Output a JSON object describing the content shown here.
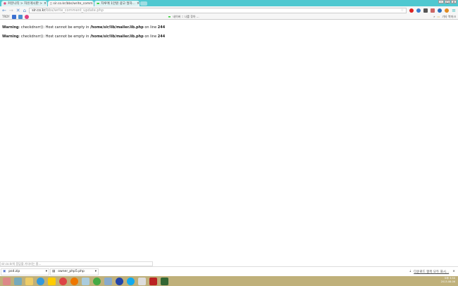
{
  "tabs": [
    {
      "label": "커뮤니티 > 자유게시판 >"
    },
    {
      "label": "sir.co.kr/bbs/write_comm"
    },
    {
      "label": "자루에 1만원 광고 절차..."
    }
  ],
  "toolbar": {
    "url_host": "sir.co.kr",
    "url_path": "/bbs/write_comment_update.php"
  },
  "bookmarks": {
    "items": [
      "TRDY"
    ],
    "center": "네이버 :: 나를 찾아 ...",
    "other": "기타 북마크"
  },
  "warnings": [
    {
      "label": "Warning",
      "msg": ": checkdnsrr(): Host cannot be empty in ",
      "file": "/home/sir/lib/mailer.lib.php",
      "online": " on line ",
      "line": "244"
    },
    {
      "label": "Warning",
      "msg": ": checkdnsrr(): Host cannot be empty in ",
      "file": "/home/sir/lib/mailer.lib.php",
      "online": " on line ",
      "line": "244"
    }
  ],
  "status": "sir.co.kr의 응답을 기다리는 중...",
  "downloads": {
    "items": [
      "psd.zip",
      "owner_php5.php"
    ],
    "show_all": "다운로드 항목 모두 표시..."
  },
  "tray": {
    "time": "오후 3:50",
    "date": "2013-08-06"
  },
  "colors": {
    "titlebar": "#4fc8d0",
    "taskbar": "#bfb07a"
  }
}
